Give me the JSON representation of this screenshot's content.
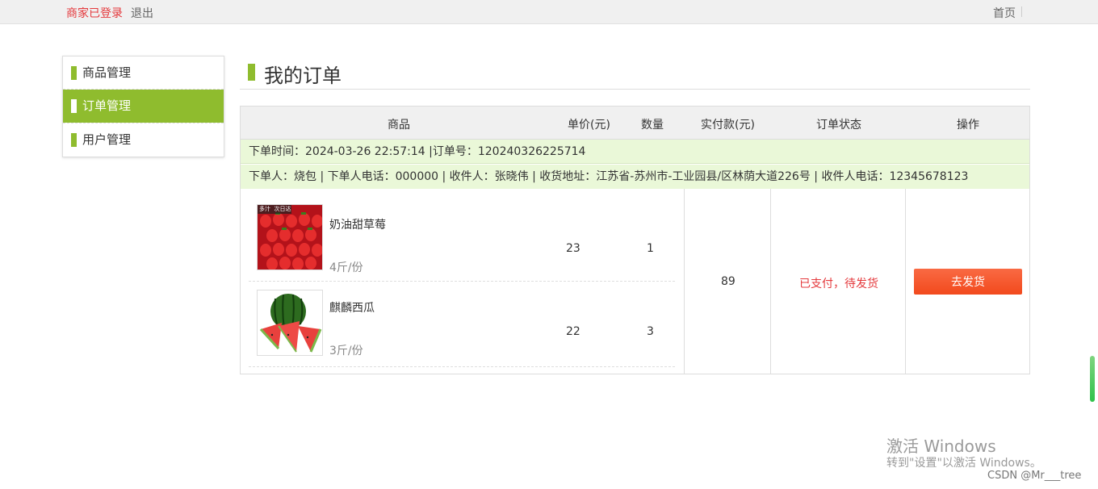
{
  "topbar": {
    "login_status": "商家已登录",
    "logout": "退出",
    "home": "首页"
  },
  "sidebar": {
    "items": [
      {
        "label": "商品管理"
      },
      {
        "label": "订单管理",
        "active": true
      },
      {
        "label": "用户管理"
      }
    ]
  },
  "main": {
    "title": "我的订单",
    "headers": [
      "商品",
      "单价(元)",
      "数量",
      "实付款(元)",
      "订单状态",
      "操作"
    ],
    "order": {
      "time_line": "下单时间：2024-03-26 22:57:14 |订单号：120240326225714",
      "buyer_line": "下单人：烧包 | 下单人电话：000000 | 收件人：张晓伟 | 收货地址：江苏省-苏州市-工业园县/区林荫大道226号 | 收件人电话：12345678123",
      "items": [
        {
          "name": "奶油甜草莓",
          "spec": "4斤/份",
          "price": "23",
          "qty": "1",
          "image": "strawberry-image",
          "badge": "多汁  次日达"
        },
        {
          "name": "麒麟西瓜",
          "spec": "3斤/份",
          "price": "22",
          "qty": "3",
          "image": "watermelon-image"
        }
      ],
      "total": "89",
      "status": "已支付，待发货",
      "action": "去发货"
    }
  },
  "watermark": {
    "line1": "激活 Windows",
    "line2": "转到\"设置\"以激活 Windows。",
    "csdn": "CSDN @Mr___tree"
  },
  "colors": {
    "accent_green": "#8fbc2e",
    "info_row_bg": "#eaf8d8",
    "status_red": "#e4393c",
    "button_orange": "#f24a1d"
  }
}
